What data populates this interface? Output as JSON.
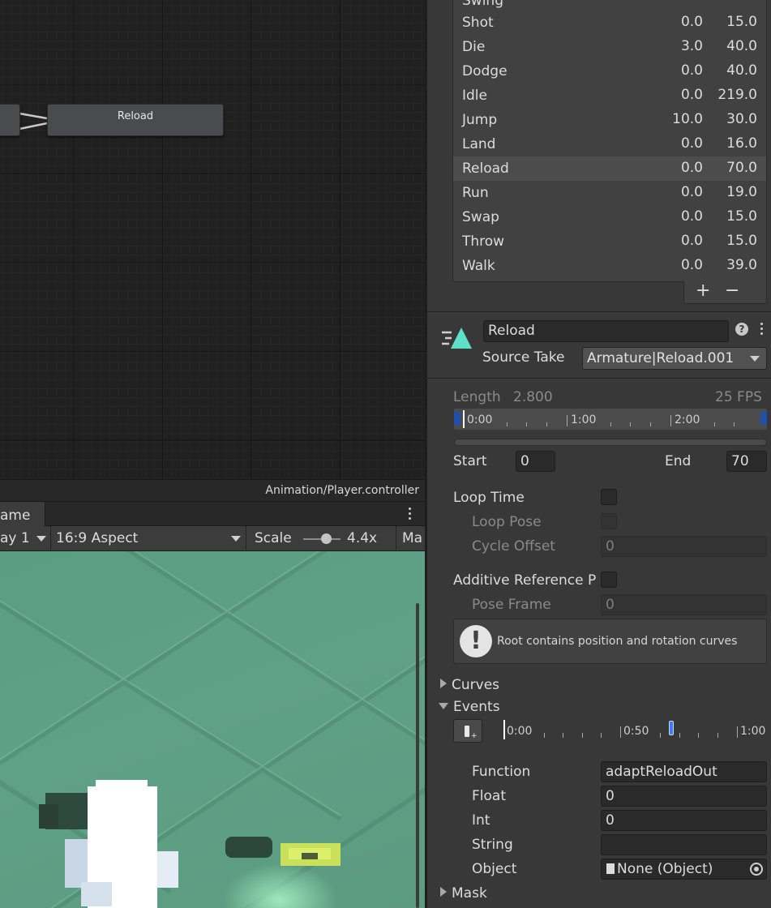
{
  "graph": {
    "node_label": "Reload",
    "controller_path": "Animation/Player.controller"
  },
  "game": {
    "tab_label": "ame",
    "display_label": "ay 1",
    "aspect_label": "16:9 Aspect",
    "scale_label": "Scale",
    "scale_value": "4.4x",
    "maximize_label": "Ma"
  },
  "clips": {
    "partial_top": "Swing",
    "items": [
      {
        "name": "Shot",
        "start": "0.0",
        "end": "15.0"
      },
      {
        "name": "Die",
        "start": "3.0",
        "end": "40.0"
      },
      {
        "name": "Dodge",
        "start": "0.0",
        "end": "40.0"
      },
      {
        "name": "Idle",
        "start": "0.0",
        "end": "219.0"
      },
      {
        "name": "Jump",
        "start": "10.0",
        "end": "30.0"
      },
      {
        "name": "Land",
        "start": "0.0",
        "end": "16.0"
      },
      {
        "name": "Reload",
        "start": "0.0",
        "end": "70.0"
      },
      {
        "name": "Run",
        "start": "0.0",
        "end": "19.0"
      },
      {
        "name": "Swap",
        "start": "0.0",
        "end": "15.0"
      },
      {
        "name": "Throw",
        "start": "0.0",
        "end": "15.0"
      },
      {
        "name": "Walk",
        "start": "0.0",
        "end": "39.0"
      }
    ],
    "selected": "Reload",
    "add_label": "+",
    "remove_label": "−"
  },
  "clip": {
    "name": "Reload",
    "source_take_label": "Source Take",
    "source_take_value": "Armature|Reload.001",
    "length_label": "Length",
    "length_value": "2.800",
    "fps": "25 FPS",
    "timeline_ticks": [
      "0:00",
      "1:00",
      "2:00"
    ],
    "start_label": "Start",
    "start_value": "0",
    "end_label": "End",
    "end_value": "70",
    "loop_time_label": "Loop Time",
    "loop_pose_label": "Loop Pose",
    "cycle_offset_label": "Cycle Offset",
    "cycle_offset_value": "0",
    "additive_label": "Additive Reference P",
    "pose_frame_label": "Pose Frame",
    "pose_frame_value": "0",
    "warning": "Root contains position and rotation curves",
    "curves_label": "Curves",
    "events_label": "Events",
    "event_ticks": [
      "0:00",
      "0:50",
      "1:00"
    ],
    "function_label": "Function",
    "function_value": "adaptReloadOut",
    "float_label": "Float",
    "float_value": "0",
    "int_label": "Int",
    "int_value": "0",
    "string_label": "String",
    "string_value": "",
    "object_label": "Object",
    "object_value": "None (Object)",
    "mask_label": "Mask"
  },
  "colors": {
    "accent_icon": "#5fe0c8",
    "event_marker": "#3f7cf0",
    "timeline_marker": "#1f4fa8"
  }
}
